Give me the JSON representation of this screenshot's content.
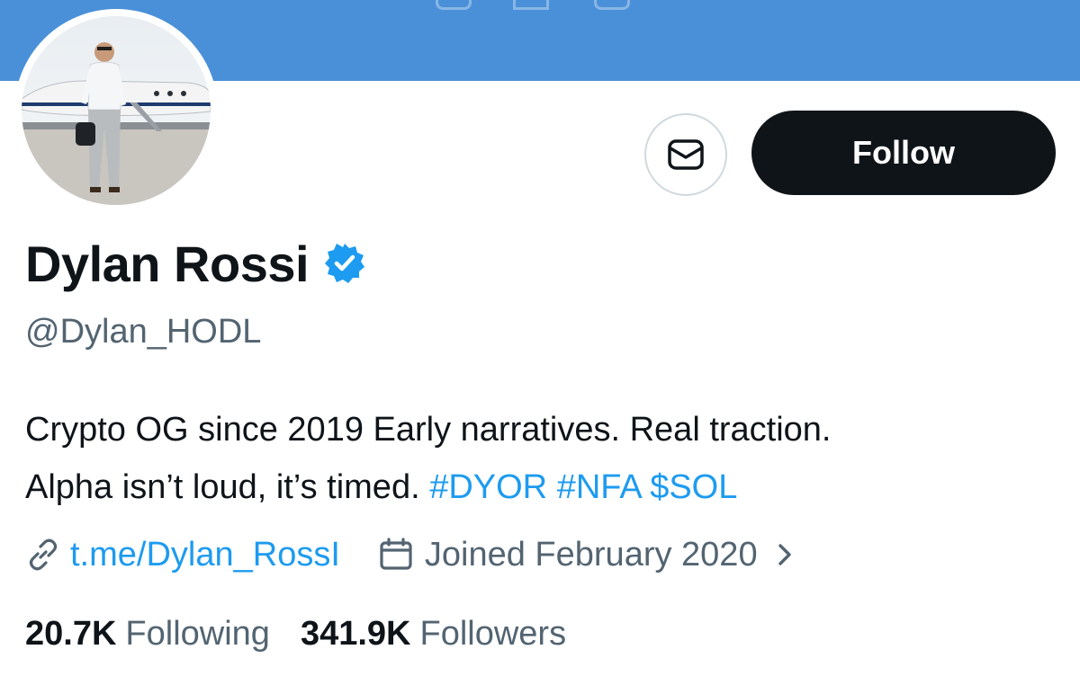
{
  "profile": {
    "name": "Dylan Rossi",
    "handle": "@Dylan_HODL",
    "verified": true,
    "bio_line1": "Crypto OG since 2019 Early narratives. Real traction.",
    "bio_line2_text": "Alpha isn’t loud, it’s timed.",
    "bio_tags": [
      "#DYOR",
      "#NFA",
      "$SOL"
    ],
    "link": "t.me/Dylan_RossI",
    "joined": "Joined February 2020"
  },
  "actions": {
    "follow_label": "Follow"
  },
  "stats": {
    "following_count": "20.7K",
    "following_label": "Following",
    "followers_count": "341.9K",
    "followers_label": "Followers"
  },
  "icons": {
    "message": "envelope-icon",
    "verified": "verified-badge-icon",
    "link": "link-icon",
    "calendar": "calendar-icon",
    "chevron": "chevron-right-icon"
  },
  "colors": {
    "banner": "#4a90d9",
    "accent": "#1d9bf0",
    "text": "#0f1419",
    "secondary": "#536471",
    "follow_bg": "#0f1419"
  }
}
